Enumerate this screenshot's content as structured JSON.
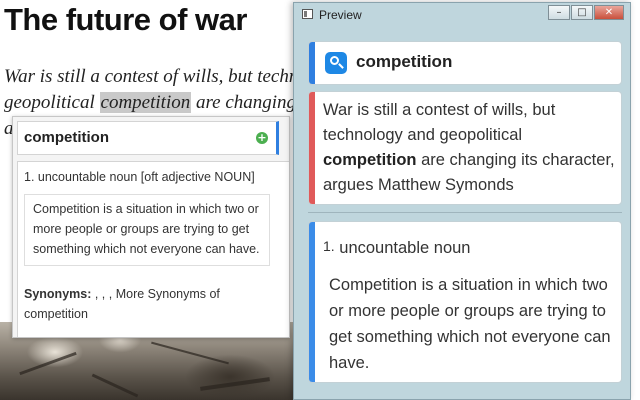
{
  "article": {
    "title": "The future of war",
    "lede_before": "War is still a contest of wills, but technology and geopolitical ",
    "lede_highlight": "competition",
    "lede_after": " are changing its character, argues Matthew Symonds"
  },
  "popup": {
    "word": "competition",
    "add_icon": "plus-circle-icon",
    "sense": "1. uncountable noun [oft adjective NOUN]",
    "definition": "Competition is a situation in which two or more people or groups are trying to get something which not everyone can have.",
    "synonyms_label": "Synonyms:",
    "synonyms_text": " , , ,   More Synonyms of competition"
  },
  "preview": {
    "window_title": "Preview",
    "buttons": {
      "minimize": "–",
      "maximize": "□",
      "close": "✕"
    },
    "head_word": "competition",
    "quote_before": "War is still a contest of wills, but technology and geopolitical ",
    "quote_bold": "competition",
    "quote_after": " are changing its character, argues Matthew Symonds",
    "sense_number": "1.",
    "sense_pos": "uncountable noun",
    "definition": "Competition is a situation in which two or more people or groups are trying to get something which not everyone can have.",
    "colors": {
      "head_strip": "#2f7fe0",
      "quote_strip": "#e05a5a",
      "sense_strip": "#3b8ce8"
    }
  }
}
